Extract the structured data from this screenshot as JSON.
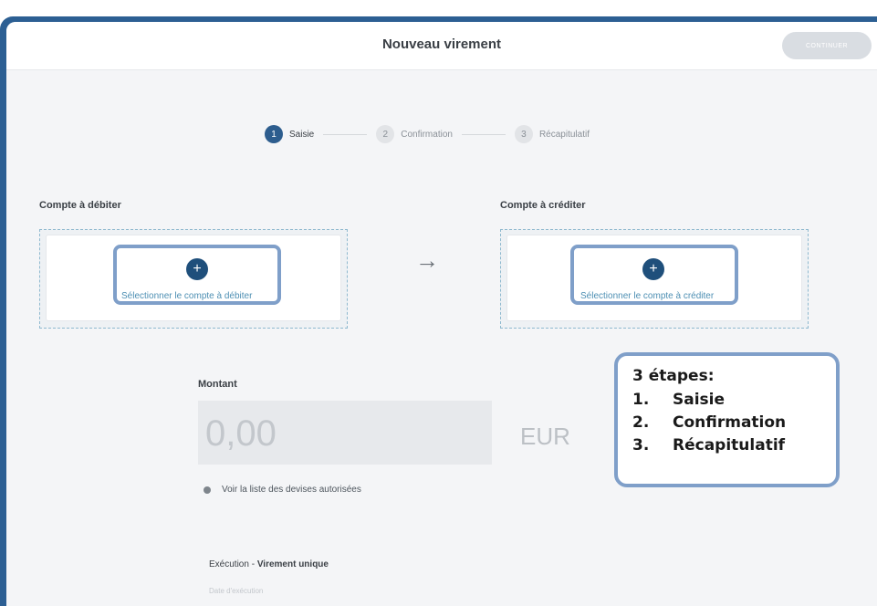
{
  "header": {
    "title": "Nouveau virement",
    "continue_label": "CONTINUER"
  },
  "stepper": {
    "steps": [
      {
        "number": "1",
        "label": "Saisie",
        "active": true
      },
      {
        "number": "2",
        "label": "Confirmation",
        "active": false
      },
      {
        "number": "3",
        "label": "Récapitulatif",
        "active": false
      }
    ]
  },
  "debit": {
    "section_label": "Compte à débiter",
    "select_label": "Sélectionner le compte à débiter",
    "plus": "+"
  },
  "credit": {
    "section_label": "Compte à créditer",
    "select_label": "Sélectionner le compte à créditer",
    "plus": "+"
  },
  "transfer_arrow": "→",
  "amount": {
    "label": "Montant",
    "placeholder": "0,00",
    "currency": "EUR",
    "devises_link": "Voir la liste des devises autorisées"
  },
  "execution": {
    "prefix": "Exécution - ",
    "type": "Virement unique",
    "date_label": "Date d'exécution"
  },
  "callout": {
    "title": "3 étapes:",
    "items": [
      {
        "num": "1.",
        "text": "Saisie"
      },
      {
        "num": "2.",
        "text": "Confirmation"
      },
      {
        "num": "3.",
        "text": "Récapitulatif"
      }
    ]
  },
  "colors": {
    "frame": "#2c5f93",
    "accent": "#2d5d8e",
    "highlight": "#7f9fc9",
    "link": "#4d8fb3"
  },
  "icons": {
    "globe": "globe-icon",
    "plus": "plus-icon",
    "arrow": "arrow-right-icon"
  }
}
